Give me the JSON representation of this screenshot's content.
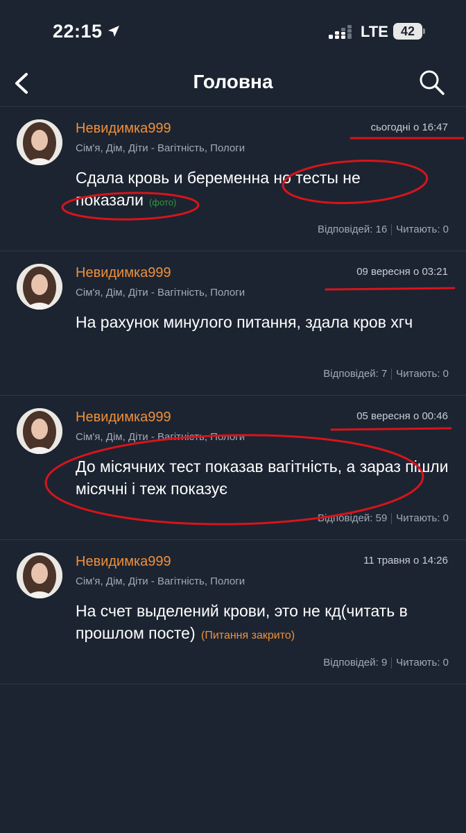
{
  "status_bar": {
    "time": "22:15",
    "network": "LTE",
    "battery": "42"
  },
  "nav": {
    "title": "Головна",
    "icons": {
      "back": "chevron-left-icon",
      "search": "search-icon"
    }
  },
  "posts": [
    {
      "username": "Невидимка999",
      "timestamp": "сьогодні о 16:47",
      "category": "Сім'я, Дім, Діти - Вагітність, Пологи",
      "text": "Сдала кровь и беременна но тесты не показали",
      "tag": "(фото)",
      "stats": {
        "replies": "Відповідей: 16",
        "reading": "Читають: 0"
      }
    },
    {
      "username": "Невидимка999",
      "timestamp": "09 вересня о 03:21",
      "category": "Сім'я, Дім, Діти - Вагітність, Пологи",
      "text": "На рахунок минулого питання, здала кров хгч",
      "stats": {
        "replies": "Відповідей: 7",
        "reading": "Читають: 0"
      }
    },
    {
      "username": "Невидимка999",
      "timestamp": "05 вересня о 00:46",
      "category": "Сім'я, Дім, Діти - Вагітність, Пологи",
      "text": "До місячних тест показав вагітність, а зараз пішли місячні і теж показує",
      "stats": {
        "replies": "Відповідей: 59",
        "reading": "Читають: 0"
      }
    },
    {
      "username": "Невидимка999",
      "timestamp": "11 травня о 14:26",
      "category": "Сім'я, Дім, Діти - Вагітність, Пологи",
      "text": "На счет выделений крови, это не кд(читать в прошлом посте)",
      "tag": "(Питання закрито)",
      "stats": {
        "replies": "Відповідей: 9",
        "reading": "Читають: 0"
      }
    }
  ],
  "colors": {
    "background": "#1c2431",
    "username": "#f0903a",
    "meta": "#a3aab6",
    "photo_tag": "#2e9b3a",
    "annotation": "#d8141b"
  }
}
